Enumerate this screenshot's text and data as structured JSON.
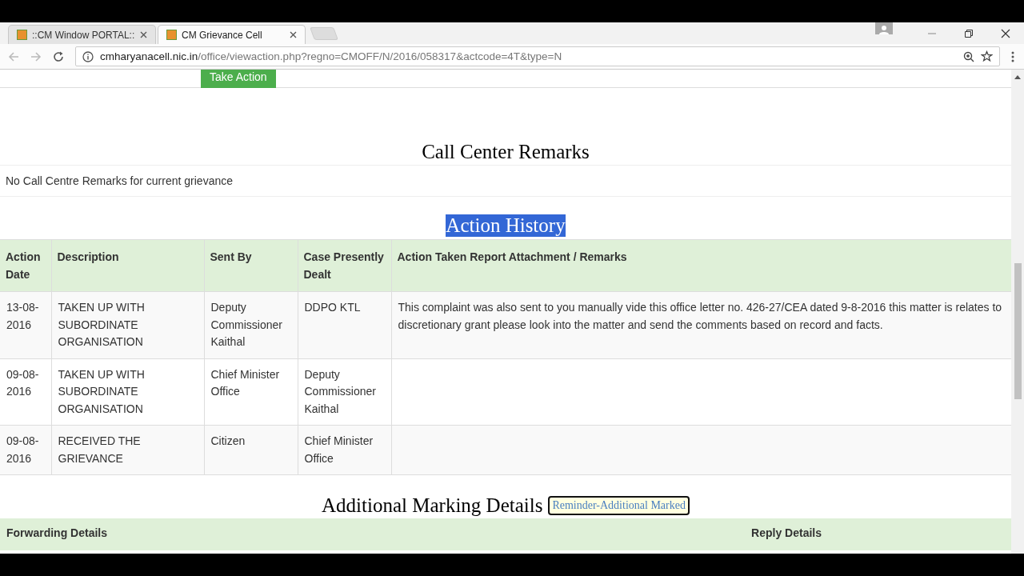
{
  "browser": {
    "tabs": [
      {
        "title": "::CM Window PORTAL::",
        "selected": false
      },
      {
        "title": "CM Grievance Cell",
        "selected": true
      }
    ],
    "url": {
      "host": "cmharyanacell.nic.in",
      "path": "/office/viewaction.php?regno=CMOFF/N/2016/058317&actcode=4T&type=N"
    }
  },
  "take_action_button": "Take Action",
  "call_center": {
    "heading": "Call Center Remarks",
    "message": "No Call Centre Remarks for current grievance"
  },
  "action_history": {
    "heading": "Action History",
    "heading_highlighted": true,
    "columns": [
      "Action Date",
      "Description",
      "Sent By",
      "Case Presently Dealt",
      "Action Taken Report Attachment / Remarks"
    ],
    "rows": [
      {
        "date": "13-08-2016",
        "description": "TAKEN UP WITH SUBORDINATE ORGANISATION",
        "sent_by": "Deputy Commissioner Kaithal",
        "dealt": "DDPO KTL",
        "remarks": "This complaint was also sent to you manually vide this office letter no. 426-27/CEA dated 9-8-2016 this matter is relates to discretionary grant please look into the matter and send the comments based on record and facts."
      },
      {
        "date": "09-08-2016",
        "description": "TAKEN UP WITH SUBORDINATE ORGANISATION",
        "sent_by": "Chief Minister Office",
        "dealt": "Deputy Commissioner Kaithal",
        "remarks": ""
      },
      {
        "date": "09-08-2016",
        "description": "RECEIVED THE GRIEVANCE",
        "sent_by": "Citizen",
        "dealt": "Chief Minister Office",
        "remarks": ""
      }
    ]
  },
  "additional_marking": {
    "heading": "Additional Marking Details",
    "badge": "Reminder-Additional Marked",
    "columns": [
      "Forwarding Details",
      "Reply Details"
    ]
  }
}
